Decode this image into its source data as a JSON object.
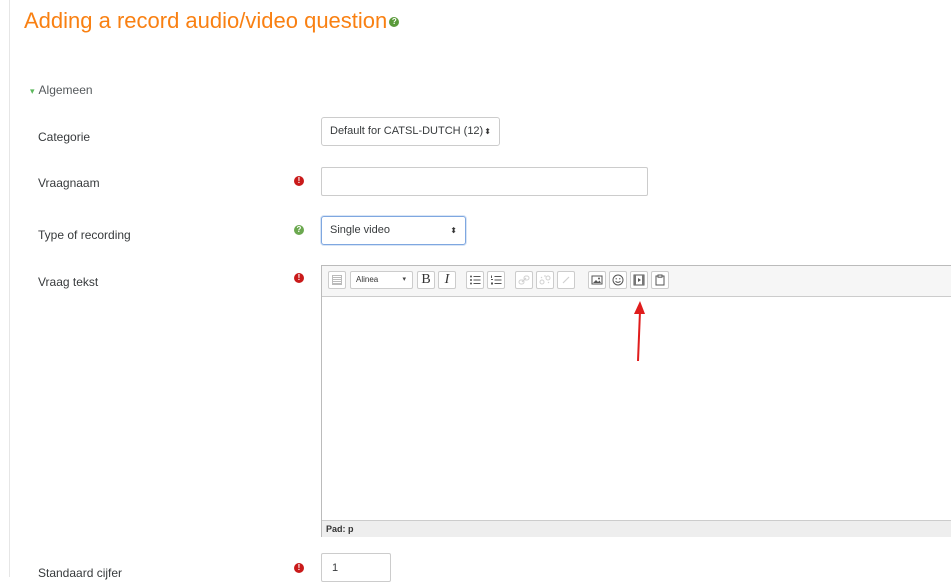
{
  "page": {
    "title": "Adding a record audio/video question"
  },
  "section": {
    "label": "Algemeen"
  },
  "fields": {
    "category": {
      "label": "Categorie",
      "value": "Default for CATSL-DUTCH (12)"
    },
    "name": {
      "label": "Vraagnaam",
      "value": ""
    },
    "recording_type": {
      "label": "Type of recording",
      "value": "Single video"
    },
    "question_text": {
      "label": "Vraag tekst",
      "paragraph_format": "Alinea",
      "bold": "B",
      "italic": "I",
      "status_path": "Pad: p"
    },
    "default_mark": {
      "label": "Standaard cijfer",
      "value": "1"
    }
  },
  "icons": {
    "required": "!",
    "help": "?",
    "section_toggle": "▾",
    "select_arrows": "⬍",
    "dropdown": "▾"
  },
  "colors": {
    "title": "#f98012",
    "required": "#c91a1a",
    "help": "#6ba84f",
    "annotation_arrow": "#e01c1c"
  }
}
